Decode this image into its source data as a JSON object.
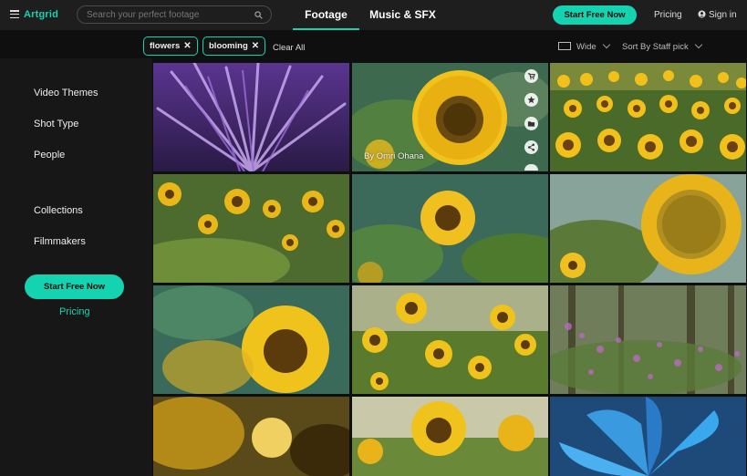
{
  "header": {
    "logo_text": "Artgrid",
    "search_placeholder": "Search your perfect footage",
    "tabs": [
      {
        "label": "Footage",
        "active": true
      },
      {
        "label": "Music & SFX",
        "active": false
      }
    ],
    "cta_label": "Start Free Now",
    "pricing_label": "Pricing",
    "signin_label": "Sign in"
  },
  "filters": {
    "chips": [
      "flowers",
      "blooming"
    ],
    "clear_label": "Clear All",
    "layout_label": "Wide",
    "sort_label": "Sort By Staff pick"
  },
  "sidebar": {
    "items": [
      "Video Themes",
      "Shot Type",
      "People",
      "Collections",
      "Filmmakers"
    ],
    "cta_label": "Start Free Now",
    "pricing_label": "Pricing"
  },
  "grid": {
    "hover_credit": "By Omri Ohana",
    "hover_actions": [
      "cart-icon",
      "star-icon",
      "folder-icon",
      "share-icon",
      "more-icon"
    ],
    "tiles": [
      "purple-thistle-closeup",
      "sunflower-hover",
      "sunflower-field-wide",
      "sunflowers-meadow",
      "sunflower-bokeh",
      "sunflower-large-right",
      "sunflower-closeup-left",
      "sunflowers-cluster",
      "purple-wildflowers-forest",
      "sunflower-blur-dark",
      "sunflowers-bright",
      "blue-flower-closeup"
    ]
  },
  "colors": {
    "accent": "#14d3b0",
    "background": "#0f0f0f",
    "sidebar": "#171717",
    "topbar": "#1e1e1e"
  }
}
